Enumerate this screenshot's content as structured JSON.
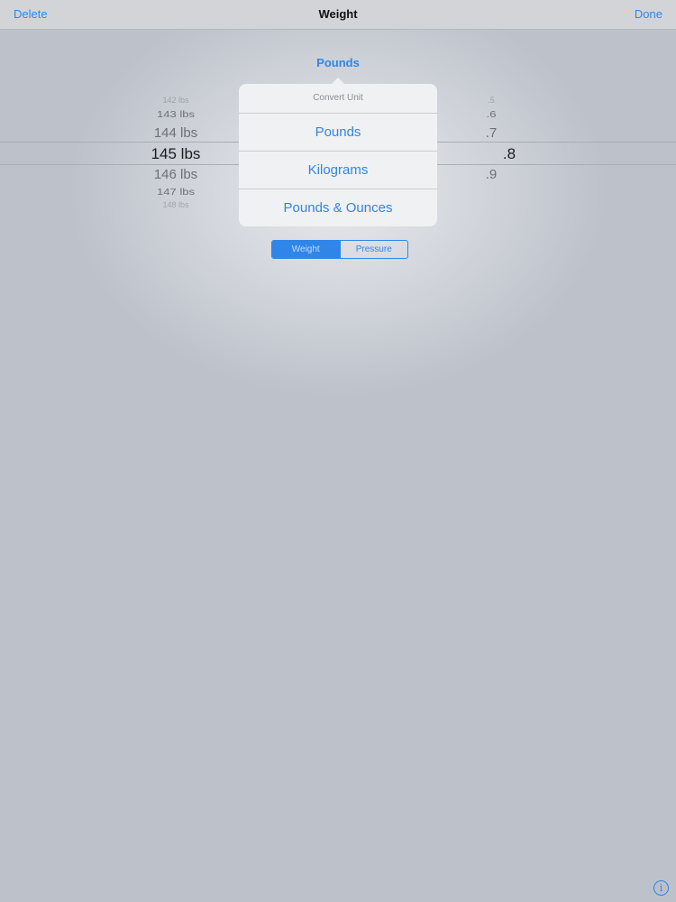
{
  "navbar": {
    "left_label": "Delete",
    "title": "Weight",
    "right_label": "Done"
  },
  "unit_header": "Pounds",
  "picker": {
    "pounds_column": [
      "142 lbs",
      "143 lbs",
      "144 lbs",
      "145 lbs",
      "146 lbs",
      "147 lbs",
      "148 lbs"
    ],
    "selected_pounds": "145 lbs",
    "decimal_column": [
      ".5",
      ".6",
      ".7",
      ".8",
      ".9"
    ],
    "selected_decimal": ".8"
  },
  "popover": {
    "title": "Convert Unit",
    "items": [
      "Pounds",
      "Kilograms",
      "Pounds & Ounces"
    ]
  },
  "segmented": {
    "options": [
      "Weight",
      "Pressure"
    ],
    "selected": "Weight"
  },
  "info_icon": "info-circle-icon",
  "colors": {
    "accent": "#2f86e8",
    "background": "#bcc1ca"
  }
}
